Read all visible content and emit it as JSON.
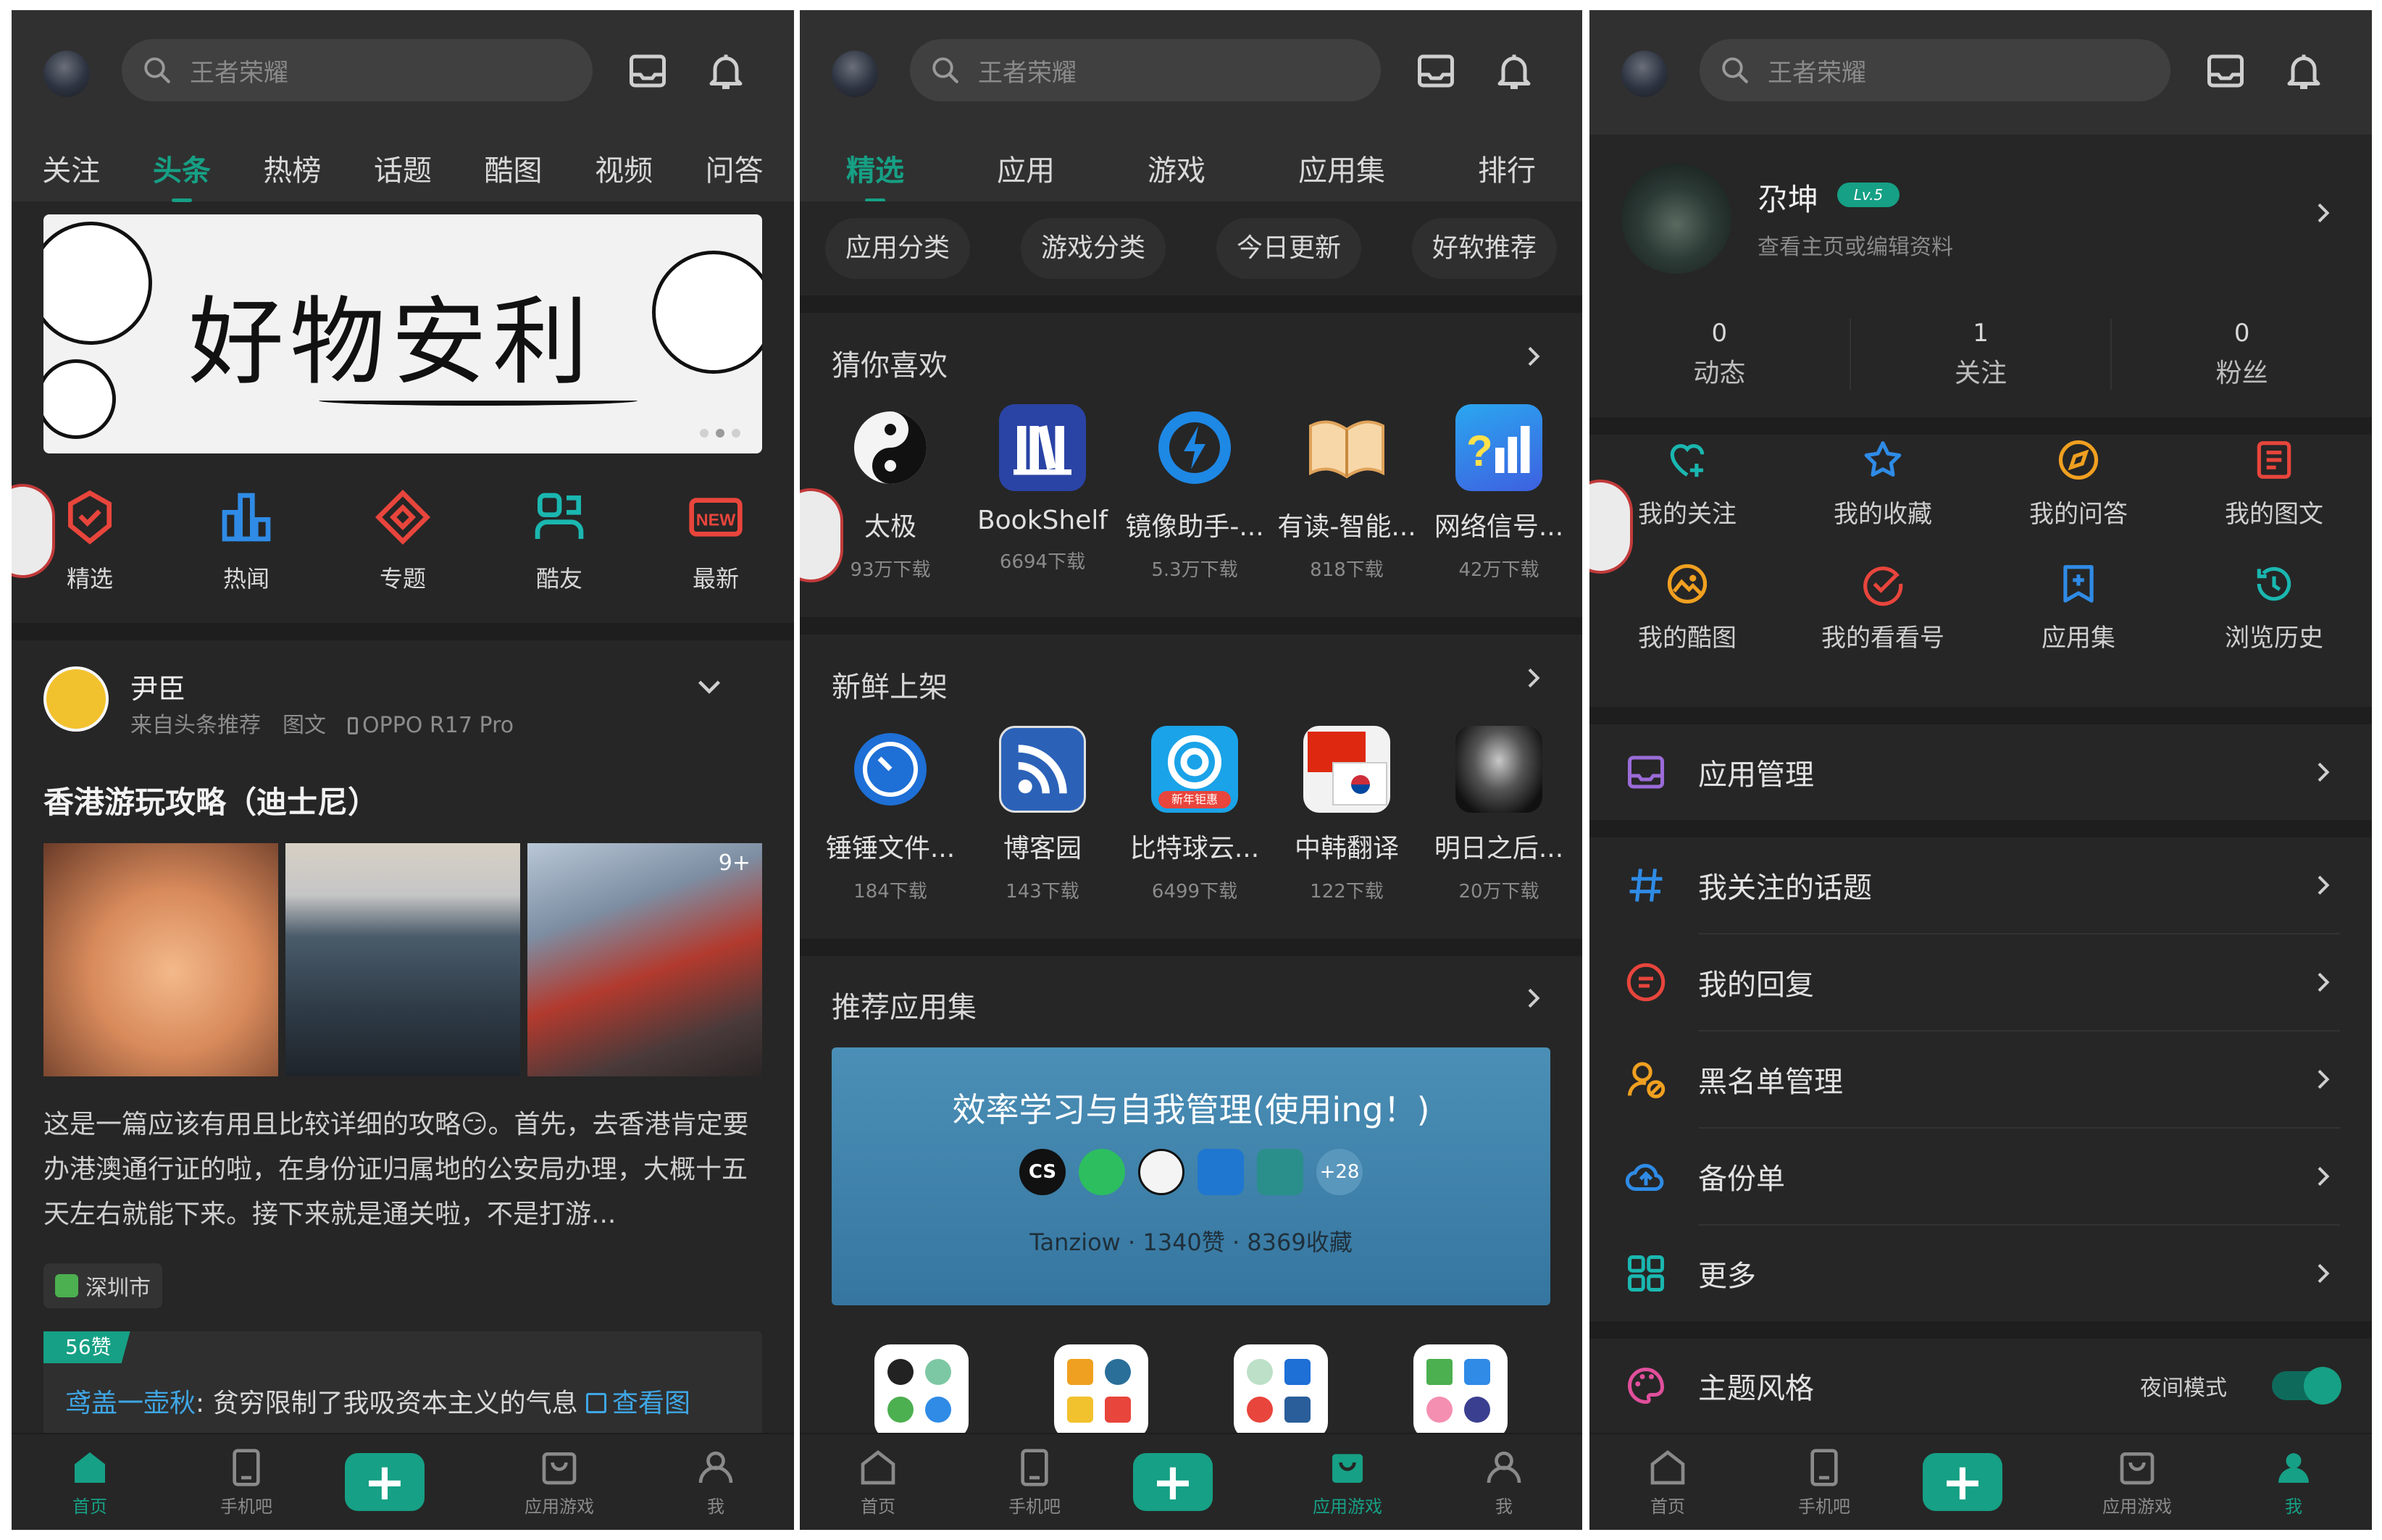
{
  "colors": {
    "accent": "#16a085",
    "panel_bg": "#262626",
    "topbar_bg": "#303030",
    "link": "#3fa7e6"
  },
  "search": {
    "placeholder": "王者荣耀"
  },
  "panel1": {
    "tabs": [
      "关注",
      "头条",
      "热榜",
      "话题",
      "酷图",
      "视频",
      "问答"
    ],
    "active_tab": "头条",
    "banner": {
      "text": "好物安利"
    },
    "quick": [
      {
        "label": "精选",
        "icon": "shield-check-icon"
      },
      {
        "label": "热闻",
        "icon": "bar-chart-icon"
      },
      {
        "label": "专题",
        "icon": "diamond-icon"
      },
      {
        "label": "酷友",
        "icon": "friends-icon"
      },
      {
        "label": "最新",
        "icon": "new-badge-icon"
      }
    ],
    "post": {
      "author": "尹臣",
      "meta": "来自头条推荐　图文　",
      "device": "OPPO R17 Pro",
      "title": "香港游玩攻略（迪士尼）",
      "photo_count": "9+",
      "body": "这是一篇应该有用且比较详细的攻略😏。首先，去香港肯定要办港澳通行证的啦，在身份证归属地的公安局办理，大概十五天左右就能下来。接下来就是通关啦，不是打游...",
      "location": "深圳市",
      "likes": "56赞",
      "comment_user": "鸢盖一壶秋",
      "comment_text": ": 贫穷限制了我吸资本主义的气息 ",
      "comment_link": "查看图"
    }
  },
  "panel2": {
    "tabs": [
      "精选",
      "应用",
      "游戏",
      "应用集",
      "排行"
    ],
    "active_tab": "精选",
    "chips": [
      "应用分类",
      "游戏分类",
      "今日更新",
      "好软推荐"
    ],
    "guess": {
      "title": "猜你喜欢",
      "apps": [
        {
          "name": "太极",
          "downloads": "93万下载"
        },
        {
          "name": "BookShelf",
          "downloads": "6694下载"
        },
        {
          "name": "镜像助手-...",
          "downloads": "5.3万下载"
        },
        {
          "name": "有读-智能...",
          "downloads": "818下载"
        },
        {
          "name": "网络信号...",
          "downloads": "42万下载"
        }
      ]
    },
    "fresh": {
      "title": "新鲜上架",
      "apps": [
        {
          "name": "锤锤文件...",
          "downloads": "184下载"
        },
        {
          "name": "博客园",
          "downloads": "143下载"
        },
        {
          "name": "比特球云...",
          "downloads": "6499下载",
          "badge": "新年钜惠"
        },
        {
          "name": "中韩翻译",
          "downloads": "122下载"
        },
        {
          "name": "明日之后...",
          "downloads": "20万下载"
        }
      ]
    },
    "collections": {
      "title": "推荐应用集",
      "card_title": "效率学习与自我管理(使用ing！)",
      "more_count": "+28",
      "meta": "Tanziow · 1340赞 · 8369收藏",
      "cs_label": "CS"
    }
  },
  "panel3": {
    "profile": {
      "name": "尕坤",
      "level": "Lv.5",
      "subtitle": "查看主页或编辑资料"
    },
    "stats": [
      {
        "value": "0",
        "label": "动态"
      },
      {
        "value": "1",
        "label": "关注"
      },
      {
        "value": "0",
        "label": "粉丝"
      }
    ],
    "grid": [
      {
        "label": "我的关注",
        "icon": "heart-plus-icon",
        "color": "#1ab7b0"
      },
      {
        "label": "我的收藏",
        "icon": "star-icon",
        "color": "#2f8be6"
      },
      {
        "label": "我的问答",
        "icon": "compass-icon",
        "color": "#f0a020"
      },
      {
        "label": "我的图文",
        "icon": "document-icon",
        "color": "#e8453c"
      },
      {
        "label": "我的酷图",
        "icon": "image-circle-icon",
        "color": "#f0a020"
      },
      {
        "label": "我的看看号",
        "icon": "check-circle-icon",
        "color": "#e8453c"
      },
      {
        "label": "应用集",
        "icon": "bookmark-icon",
        "color": "#2f8be6"
      },
      {
        "label": "浏览历史",
        "icon": "history-icon",
        "color": "#1ab7b0"
      }
    ],
    "menu": [
      {
        "label": "应用管理",
        "icon": "inbox-icon",
        "color": "#9b6bd8"
      },
      {
        "label": "我关注的话题",
        "icon": "hashtag-icon",
        "color": "#2f8be6"
      },
      {
        "label": "我的回复",
        "icon": "reply-icon",
        "color": "#e8453c"
      },
      {
        "label": "黑名单管理",
        "icon": "blacklist-icon",
        "color": "#f0a020"
      },
      {
        "label": "备份单",
        "icon": "cloud-upload-icon",
        "color": "#2f8be6"
      },
      {
        "label": "更多",
        "icon": "grid-icon",
        "color": "#1ab7b0"
      }
    ],
    "theme": {
      "label": "主题风格",
      "toggle_label": "夜间模式",
      "night_mode": true
    }
  },
  "navbar": {
    "items": [
      "首页",
      "手机吧",
      "",
      "应用游戏",
      "我"
    ],
    "plus": "+"
  }
}
